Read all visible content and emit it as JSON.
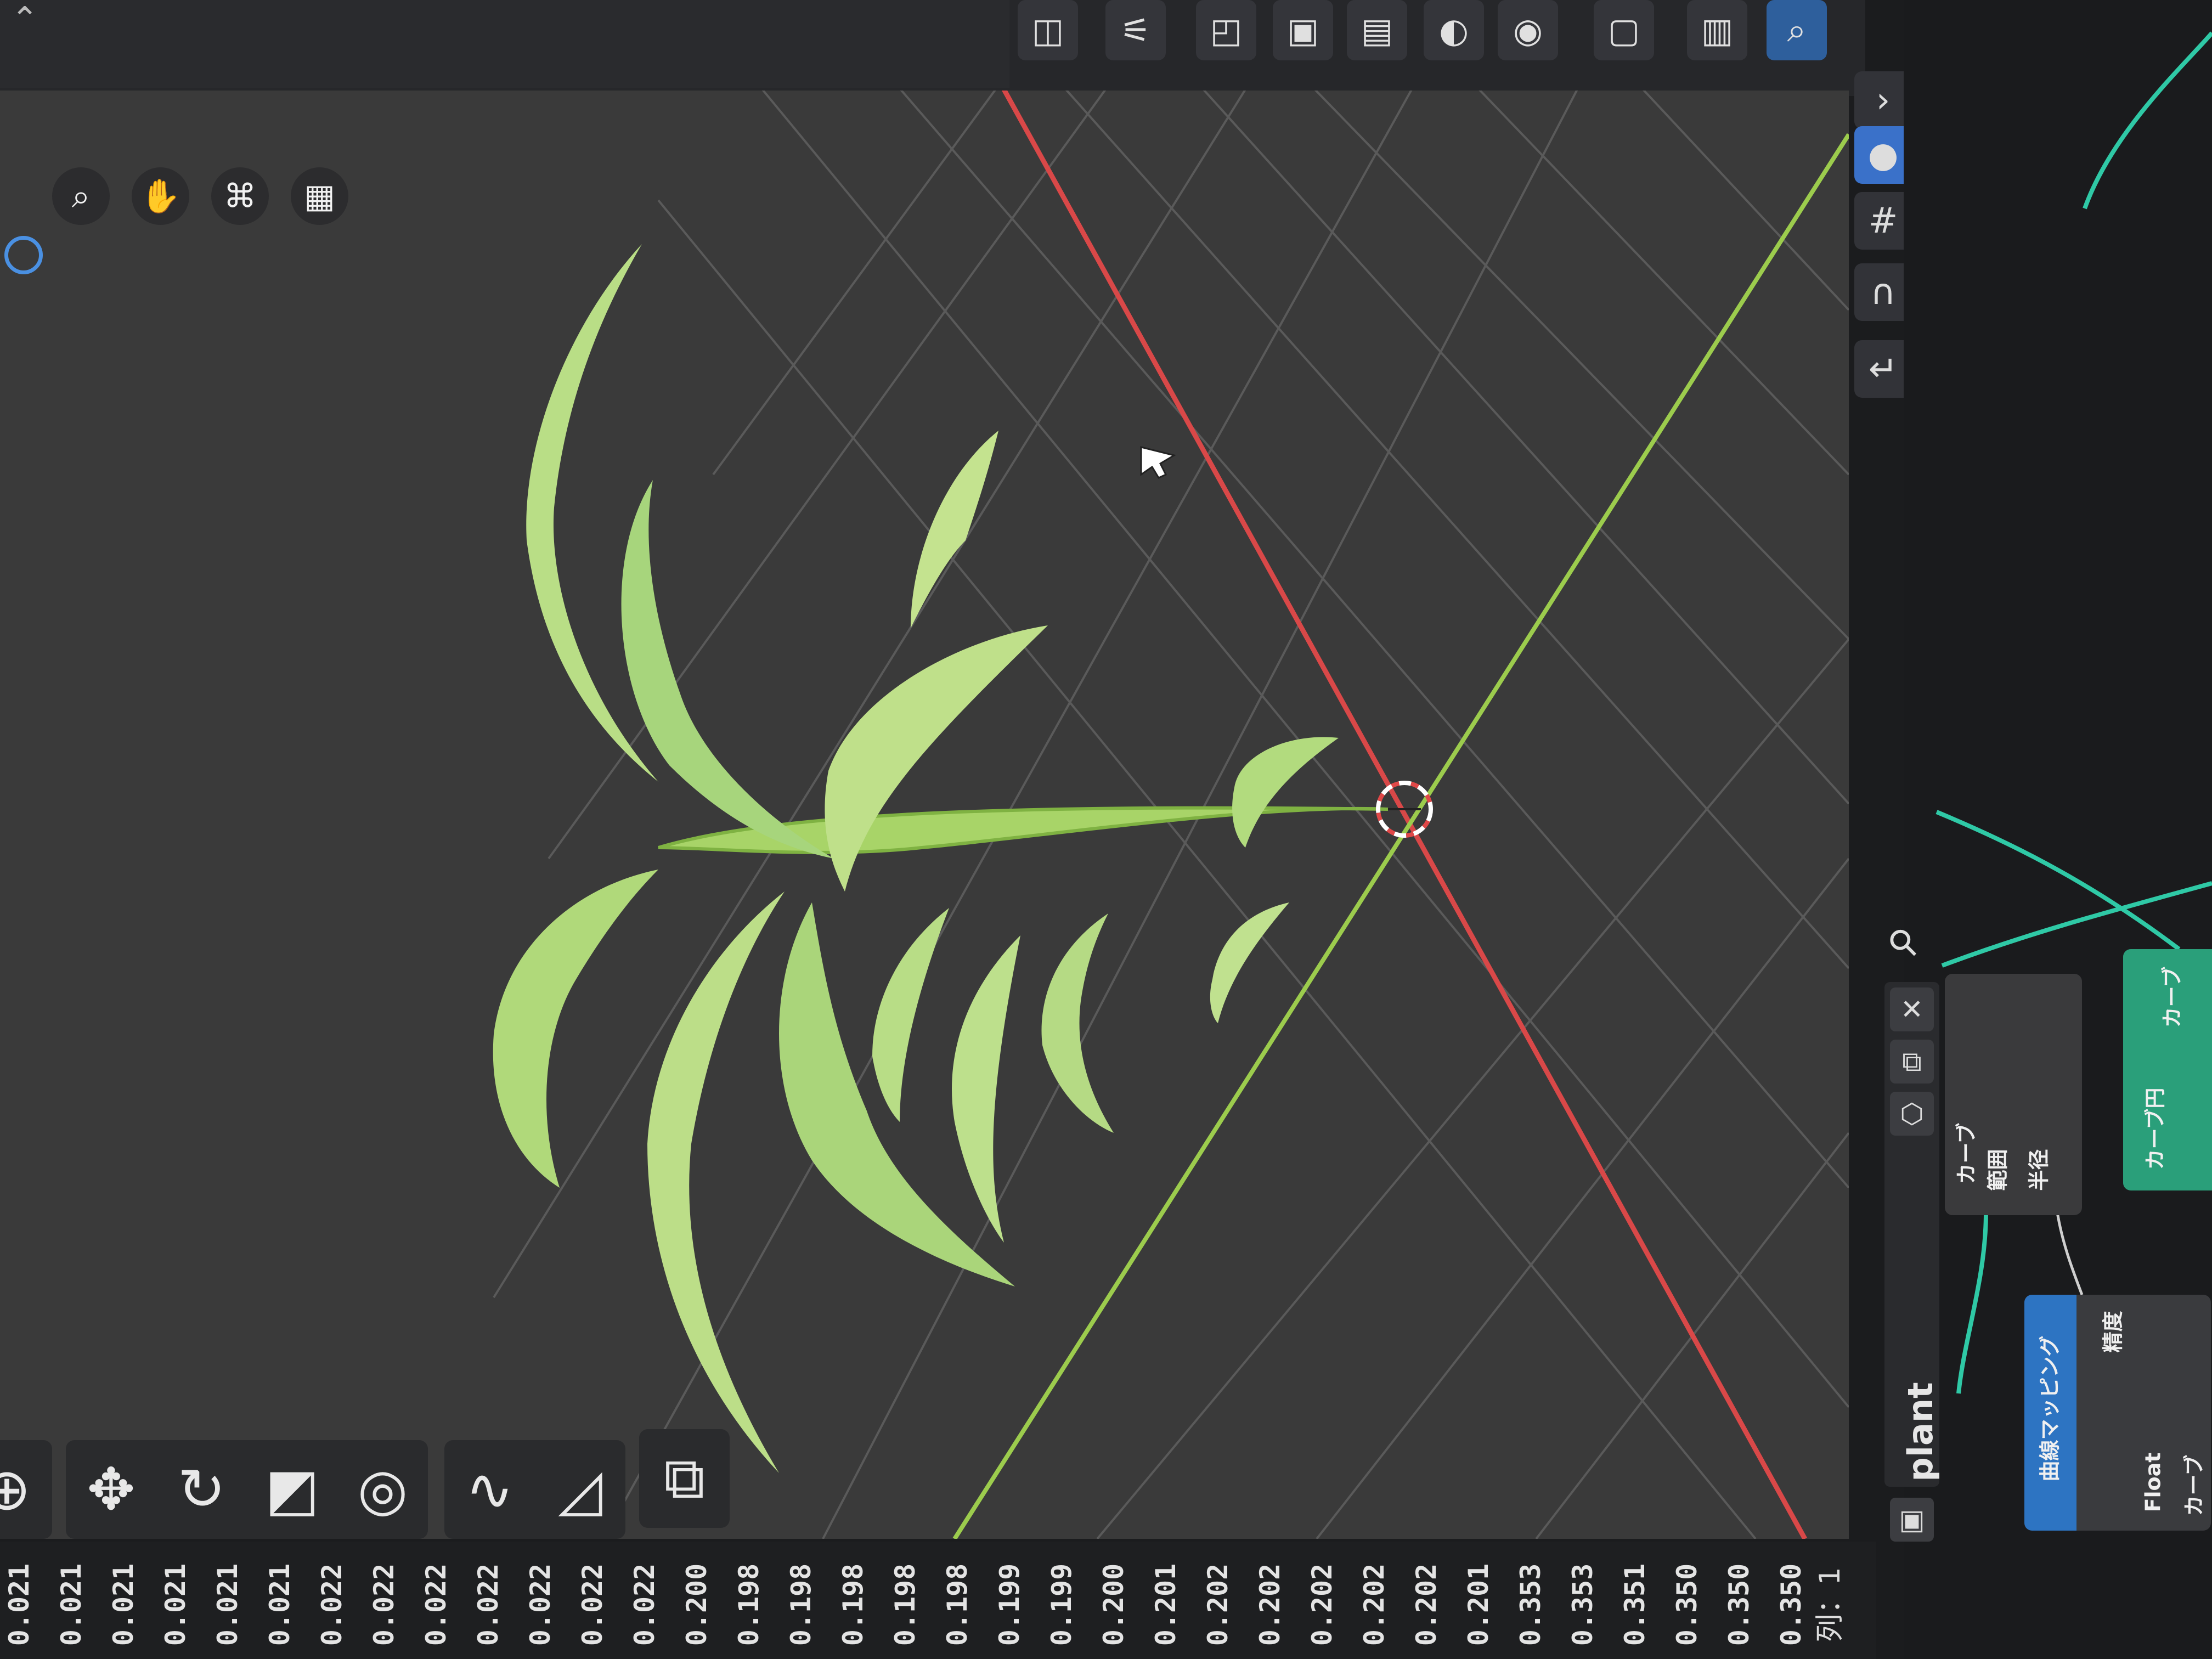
{
  "app": {
    "mode_icons": [
      "toggle-icon",
      "sliders-icon",
      "layers-icon",
      "image-icon",
      "gallery-icon",
      "render-icon",
      "overlay-icon",
      "compositor-icon",
      "node-icon",
      "search-icon",
      "curve-icon",
      "sphere-icon"
    ]
  },
  "viewport": {
    "nav_gizmos": [
      "zoom-icon",
      "hand-icon",
      "camera-icon",
      "grid-icon"
    ],
    "axis_colors": {
      "x": "#e05a5a",
      "y": "#9ccc4d"
    },
    "object_name": "plant"
  },
  "toolbar": {
    "tools": [
      {
        "name": "cursor-tool",
        "glyph": "⊕"
      },
      {
        "name": "move-tool",
        "glyph": "✥"
      },
      {
        "name": "rotate-tool",
        "glyph": "↻"
      },
      {
        "name": "scale-tool",
        "glyph": "◩"
      },
      {
        "name": "transform-tool",
        "glyph": "◎"
      },
      {
        "name": "draw-curve-tool",
        "glyph": "∿"
      },
      {
        "name": "measure-tool",
        "glyph": "◿"
      },
      {
        "name": "add-cube-tool",
        "glyph": "⧉"
      }
    ]
  },
  "ruler": {
    "values": [
      "0.021",
      "0.021",
      "0.021",
      "0.021",
      "0.021",
      "0.021",
      "0.022",
      "0.022",
      "0.022",
      "0.022",
      "0.022",
      "0.022",
      "0.022",
      "0.200",
      "0.198",
      "0.198",
      "0.198",
      "0.198",
      "0.198",
      "0.199",
      "0.199",
      "0.200",
      "0.201",
      "0.202",
      "0.202",
      "0.202",
      "0.202",
      "0.202",
      "0.201",
      "0.353",
      "0.353",
      "0.351",
      "0.350",
      "0.350",
      "0.350"
    ],
    "status": "列：1"
  },
  "node_editor": {
    "plant_label": "plant",
    "group_node_labels": [
      "カーブ",
      "範囲",
      "半径"
    ],
    "curve_node_label": "カーブ",
    "curve_node_sub": "カーブ円",
    "texture_node_label": "曲線マッピング",
    "texture_fields": [
      "精度",
      "Float",
      "カーブ"
    ]
  }
}
